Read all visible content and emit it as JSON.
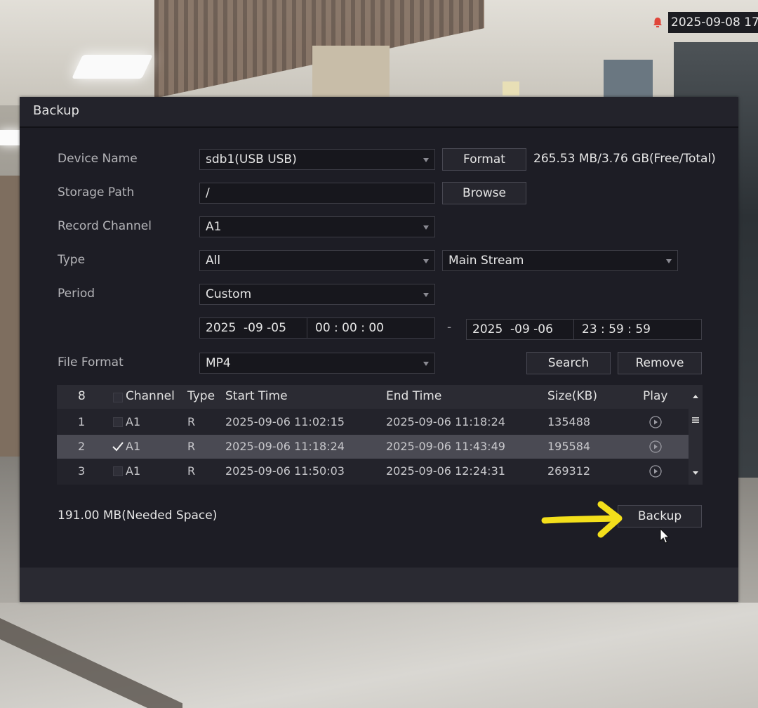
{
  "clock": {
    "datetime": "2025-09-08 17"
  },
  "dialog": {
    "title": "Backup",
    "device_name": {
      "label": "Device Name",
      "value": "sdb1(USB USB)"
    },
    "format_button": "Format",
    "capacity": "265.53 MB/3.76 GB(Free/Total)",
    "storage_path": {
      "label": "Storage Path",
      "value": "/"
    },
    "browse_button": "Browse",
    "record_channel": {
      "label": "Record Channel",
      "value": "A1"
    },
    "type": {
      "label": "Type",
      "value": "All",
      "stream": "Main Stream"
    },
    "period": {
      "label": "Period",
      "value": "Custom"
    },
    "start": {
      "year": "2025",
      "month_day": "-09 -05",
      "time": "00 : 00 : 00"
    },
    "range_separator": "-",
    "end": {
      "year": "2025",
      "month_day": "-09 -06",
      "time": "23 : 59 : 59"
    },
    "file_format": {
      "label": "File Format",
      "value": "MP4"
    },
    "search_button": "Search",
    "remove_button": "Remove",
    "table": {
      "count": "8",
      "headers": {
        "channel": "Channel",
        "type": "Type",
        "start": "Start Time",
        "end": "End Time",
        "size": "Size(KB)",
        "play": "Play"
      },
      "rows": [
        {
          "index": "1",
          "checked": false,
          "channel": "A1",
          "type": "R",
          "start": "2025-09-06 11:02:15",
          "end": "2025-09-06 11:18:24",
          "size": "135488"
        },
        {
          "index": "2",
          "checked": true,
          "channel": "A1",
          "type": "R",
          "start": "2025-09-06 11:18:24",
          "end": "2025-09-06 11:43:49",
          "size": "195584"
        },
        {
          "index": "3",
          "checked": false,
          "channel": "A1",
          "type": "R",
          "start": "2025-09-06 11:50:03",
          "end": "2025-09-06 12:24:31",
          "size": "269312"
        }
      ]
    },
    "needed_space": "191.00 MB(Needed Space)",
    "backup_button": "Backup"
  },
  "colors": {
    "dialog_bg": "#1d1d25",
    "annotation_arrow": "#f3df1b",
    "alarm": "#e0463a"
  }
}
